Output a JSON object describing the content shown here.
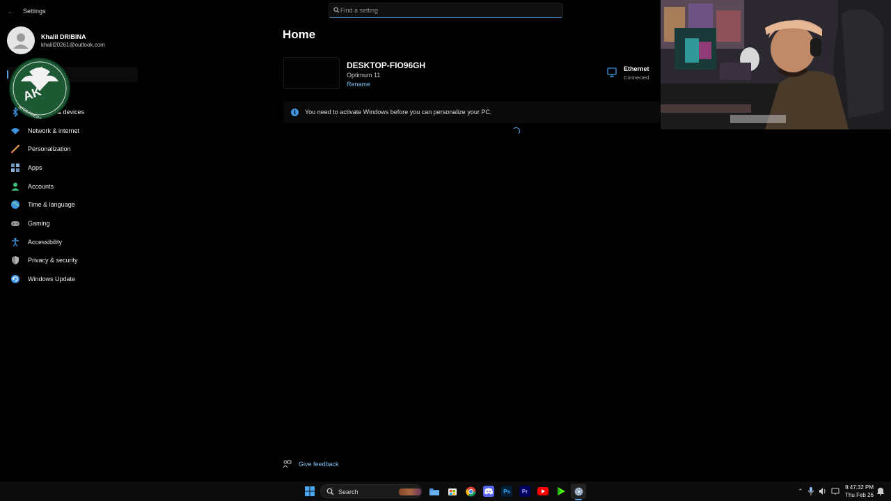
{
  "app": {
    "title": "Settings"
  },
  "search": {
    "placeholder": "Find a setting"
  },
  "profile": {
    "name": "Khalil DRIBINA",
    "email": "khalil20261@outlook.com"
  },
  "sidebar": {
    "items": [
      {
        "label": "& devices",
        "icon": "bluetooth-icon"
      },
      {
        "label": "Network & internet",
        "icon": "wifi-icon"
      },
      {
        "label": "Personalization",
        "icon": "brush-icon"
      },
      {
        "label": "Apps",
        "icon": "apps-icon"
      },
      {
        "label": "Accounts",
        "icon": "person-icon"
      },
      {
        "label": "Time & language",
        "icon": "globe-icon"
      },
      {
        "label": "Gaming",
        "icon": "controller-icon"
      },
      {
        "label": "Accessibility",
        "icon": "accessibility-icon"
      },
      {
        "label": "Privacy & security",
        "icon": "shield-icon"
      },
      {
        "label": "Windows Update",
        "icon": "update-icon"
      }
    ]
  },
  "main": {
    "title": "Home",
    "pc": {
      "name": "DESKTOP-FIO96GH",
      "model": "Optimum 11",
      "rename": "Rename"
    },
    "network": {
      "title": "Ethernet",
      "status": "Connected"
    },
    "banner": {
      "text": "You need to activate Windows before you can personalize your PC."
    },
    "feedback": "Give feedback"
  },
  "taskbar": {
    "search_label": "Search",
    "apps": [
      "file-explorer-icon",
      "store-icon",
      "chrome-icon",
      "discord-icon",
      "photoshop-icon",
      "premiere-icon",
      "youtube-icon",
      "game-icon",
      "settings-icon"
    ],
    "time": "8:47:32 PM",
    "date": "Thu Feb 26"
  },
  "colors": {
    "accent": "#5aa0e8",
    "link": "#7cc0f5",
    "background": "#000000"
  }
}
